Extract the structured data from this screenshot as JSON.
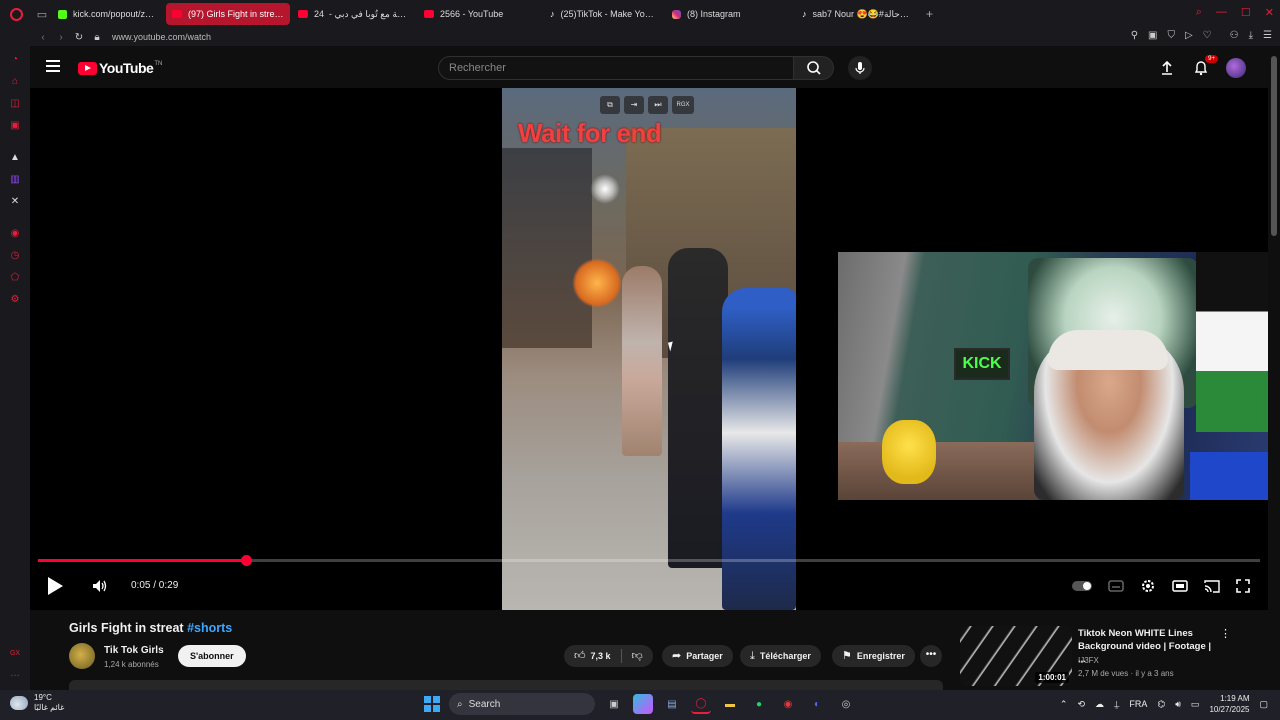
{
  "browser": {
    "tabs": [
      {
        "label": "kick.com/popout/zanoun",
        "favicon": "kick-icon",
        "active": false
      },
      {
        "label": "(97) Girls Fight in streat #",
        "favicon": "youtube-icon",
        "active": true
      },
      {
        "label": "24 ساعة مع تُوبا في دبي - ‏",
        "favicon": "youtube-icon",
        "active": false
      },
      {
        "label": "2566 - YouTube",
        "favicon": "youtube-icon",
        "active": false
      },
      {
        "label": "(25)TikTok - Make Your D",
        "favicon": "tiktok-icon",
        "active": false
      },
      {
        "label": "(8) Instagram",
        "favicon": "instagram-icon",
        "active": false
      },
      {
        "label": "sab7 Nour 😍😂#حالة_حالة",
        "favicon": "tiktok-icon",
        "active": false
      }
    ],
    "url": "www.youtube.com/watch",
    "accent": "#e81e3c"
  },
  "youtube": {
    "logo_text": "YouTube",
    "logo_suffix": "TN",
    "search_placeholder": "Rechercher",
    "notifications_badge": "9+"
  },
  "player": {
    "overlay_text": "Wait for end",
    "overlay_toolbar_label": "RGX",
    "webcam_sign": "KICK",
    "current_time": "0:05",
    "duration": "0:29",
    "time_display": "0:05 / 0:29",
    "progress_fraction": 0.17
  },
  "video": {
    "title": "Girls Fight in streat",
    "hashtag": "#shorts",
    "channel_name": "Tik Tok Girls",
    "subscribers": "1,24 k abonnés",
    "subscribe_label": "S'abonner",
    "likes": "7,3 k",
    "share_label": "Partager",
    "download_label": "Télécharger",
    "save_label": "Enregistrer"
  },
  "recommendation": {
    "title": "Tiktok Neon WHITE Lines Background video | Footage | ...",
    "channel": "IJ3FX",
    "meta": "2,7 M de vues · il y a 3 ans",
    "duration": "1:00:01"
  },
  "taskbar": {
    "temperature": "19°C",
    "weather_text": "غائم غالبًا",
    "search_label": "Search",
    "language": "FRA",
    "time": "1:19 AM",
    "date": "10/27/2025"
  }
}
